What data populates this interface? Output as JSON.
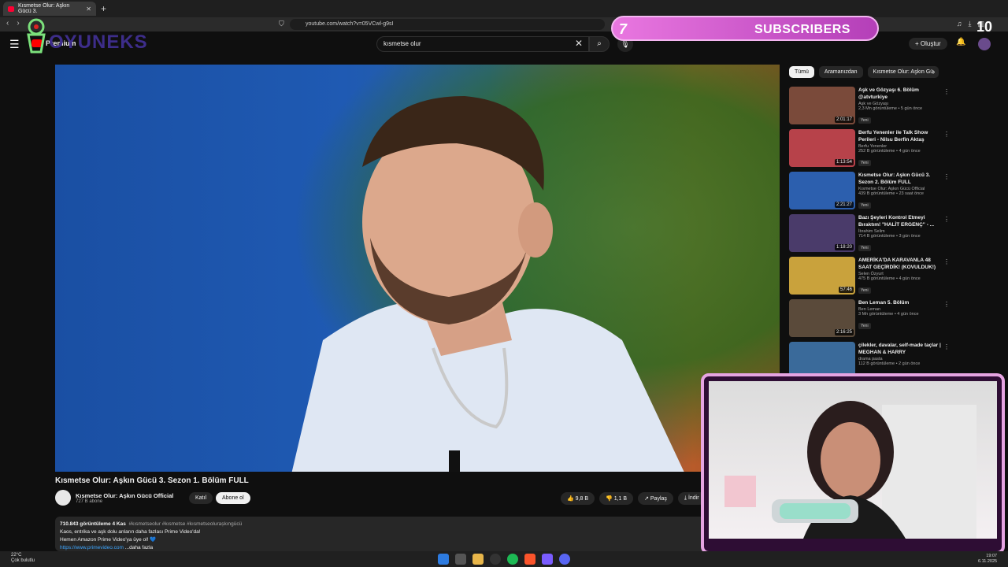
{
  "browser": {
    "tab_title": "Kısmetse Olur: Aşkın Gücü 3.",
    "new_tab": "+",
    "url": "youtube.com/watch?v=05VCwl-g9sI",
    "window_controls": [
      "—",
      "☐",
      "✕"
    ]
  },
  "youtube": {
    "logo_text": "Premium",
    "search_value": "kısmetse olur",
    "create_label": "Oluştur"
  },
  "video": {
    "title": "Kısmetse Olur: Aşkın Gücü 3. Sezon 1. Bölüm FULL",
    "channel_name": "Kısmetse Olur: Aşkın Gücü Official",
    "channel_subs": "727 B abone",
    "join_label": "Katıl",
    "subscribe_label": "Abone ol",
    "likes": "9,8 B",
    "dislikes": "1,1 B",
    "share_label": "Paylaş",
    "download_label": "İndir"
  },
  "description": {
    "views_date": "710.843 görüntüleme  4 Kas",
    "tags": "#kısmetseolur #kısmetse #kısmetseolurașkıngücü",
    "line1": "Kaos, entrika ve aşk dolu anların daha fazlası Prime Video'da!",
    "line2": "Hemen Amazon Prime Video'ya üye ol! 💙",
    "link": "https://www.primevideo.com",
    "more": "...daha fazla"
  },
  "chips": [
    "Tümü",
    "Aramanızdan",
    "Kısmetse Olur: Aşkın Gü"
  ],
  "recommendations": [
    {
      "title": "Aşk ve Gözyaşı 6. Bölüm @atvturkiye",
      "channel": "Aşk ve Gözyaşı",
      "stats": "2,3 Mn görüntüleme • 5 gün önce",
      "badge": "Yeni",
      "duration": "2:01:17",
      "color": "#7a4a3a"
    },
    {
      "title": "Berfu Yenenler ile Talk Show Perileri - Nilsu Berfin Aktaş",
      "channel": "Berfu Yenenler",
      "stats": "252 B görüntüleme • 4 gün önce",
      "badge": "Yeni",
      "duration": "1:13:54",
      "color": "#b7424a"
    },
    {
      "title": "Kısmetse Olur: Aşkın Gücü 3. Sezon 2. Bölüm FULL",
      "channel": "Kısmetse Olur: Aşkın Gücü Official",
      "stats": "439 B görüntüleme • 23 saat önce",
      "badge": "Yeni",
      "duration": "2:21:27",
      "color": "#2c5fae"
    },
    {
      "title": "Bazı Şeyleri Kontrol Etmeyi Bıraktım! \"HALİT ERGENÇ\" - ...",
      "channel": "İbrahim Selim",
      "stats": "714 B görüntüleme • 3 gün önce",
      "badge": "Yeni",
      "duration": "1:18:20",
      "color": "#4a3b6a"
    },
    {
      "title": "AMERİKA'DA KARAVANLA 48 SAAT GEÇİRDİK! (KOVULDUK!)",
      "channel": "Selen Özyurt",
      "stats": "475 B görüntüleme • 4 gün önce",
      "badge": "Yeni",
      "duration": "57:46",
      "color": "#c9a23c"
    },
    {
      "title": "Ben Leman 5. Bölüm",
      "channel": "Ben Leman",
      "stats": "3 Mn görüntüleme • 4 gün önce",
      "badge": "Yeni",
      "duration": "2:16:25",
      "color": "#5a4a3a"
    },
    {
      "title": "çilekler, davalar, self-made taçlar | MEGHAN & HARRY",
      "channel": "drama pasta",
      "stats": "112 B görüntüleme • 2 gün önce",
      "badge": "",
      "duration": "",
      "color": "#3a6a9a"
    }
  ],
  "overlay": {
    "subscriber_count": "7",
    "subscriber_label": "SUBSCRIBERS",
    "goal": "10",
    "logo_text": "OYUNEKS"
  },
  "taskbar": {
    "weather_temp": "22°C",
    "weather_desc": "Çok bulutlu",
    "time": "19:07",
    "date": "6.11.2025"
  }
}
